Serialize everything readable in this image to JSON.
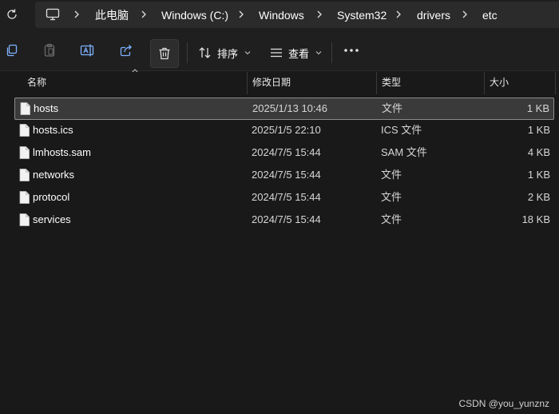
{
  "address_bar": {
    "breadcrumbs": [
      "此电脑",
      "Windows (C:)",
      "Windows",
      "System32",
      "drivers",
      "etc"
    ]
  },
  "toolbar": {
    "sort_label": "排序",
    "view_label": "查看"
  },
  "columns": {
    "name": "名称",
    "date": "修改日期",
    "type": "类型",
    "size": "大小"
  },
  "files": [
    {
      "name": "hosts",
      "date": "2025/1/13 10:46",
      "type": "文件",
      "size": "1 KB",
      "selected": true
    },
    {
      "name": "hosts.ics",
      "date": "2025/1/5 22:10",
      "type": "ICS 文件",
      "size": "1 KB"
    },
    {
      "name": "lmhosts.sam",
      "date": "2024/7/5 15:44",
      "type": "SAM 文件",
      "size": "4 KB"
    },
    {
      "name": "networks",
      "date": "2024/7/5 15:44",
      "type": "文件",
      "size": "1 KB"
    },
    {
      "name": "protocol",
      "date": "2024/7/5 15:44",
      "type": "文件",
      "size": "2 KB"
    },
    {
      "name": "services",
      "date": "2024/7/5 15:44",
      "type": "文件",
      "size": "18 KB"
    }
  ],
  "watermark": "CSDN @you_yunznz",
  "colors": {
    "background": "#191919",
    "selection": "#3a3a3a",
    "text": "#ffffff"
  }
}
